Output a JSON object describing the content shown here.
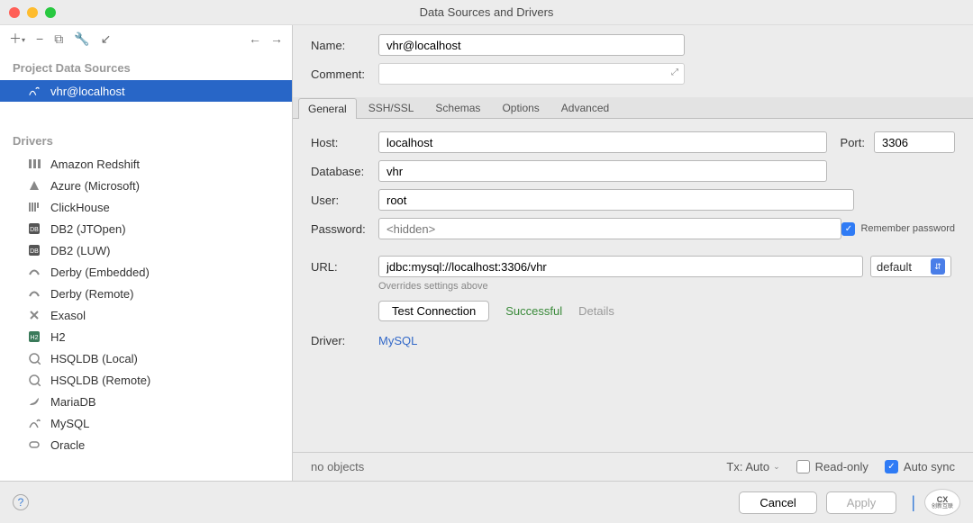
{
  "window": {
    "title": "Data Sources and Drivers"
  },
  "sidebar": {
    "sources_header": "Project Data Sources",
    "source_item": "vhr@localhost",
    "drivers_header": "Drivers",
    "drivers": [
      "Amazon Redshift",
      "Azure (Microsoft)",
      "ClickHouse",
      "DB2 (JTOpen)",
      "DB2 (LUW)",
      "Derby (Embedded)",
      "Derby (Remote)",
      "Exasol",
      "H2",
      "HSQLDB (Local)",
      "HSQLDB (Remote)",
      "MariaDB",
      "MySQL",
      "Oracle"
    ]
  },
  "form": {
    "name_label": "Name:",
    "name_value": "vhr@localhost",
    "comment_label": "Comment:",
    "tabs": [
      "General",
      "SSH/SSL",
      "Schemas",
      "Options",
      "Advanced"
    ],
    "host_label": "Host:",
    "host_value": "localhost",
    "port_label": "Port:",
    "port_value": "3306",
    "database_label": "Database:",
    "database_value": "vhr",
    "user_label": "User:",
    "user_value": "root",
    "password_label": "Password:",
    "password_placeholder": "<hidden>",
    "remember_label": "Remember password",
    "url_label": "URL:",
    "url_value": "jdbc:mysql://localhost:3306/vhr",
    "url_mode": "default",
    "url_hint": "Overrides settings above",
    "test_button": "Test Connection",
    "test_status": "Successful",
    "test_details": "Details",
    "driver_label": "Driver:",
    "driver_value": "MySQL"
  },
  "status": {
    "no_objects": "no objects",
    "tx_label": "Tx: Auto",
    "readonly_label": "Read-only",
    "autosync_label": "Auto sync"
  },
  "footer": {
    "cancel": "Cancel",
    "apply": "Apply",
    "logo_top": "CX",
    "logo_bottom": "创新互联"
  }
}
